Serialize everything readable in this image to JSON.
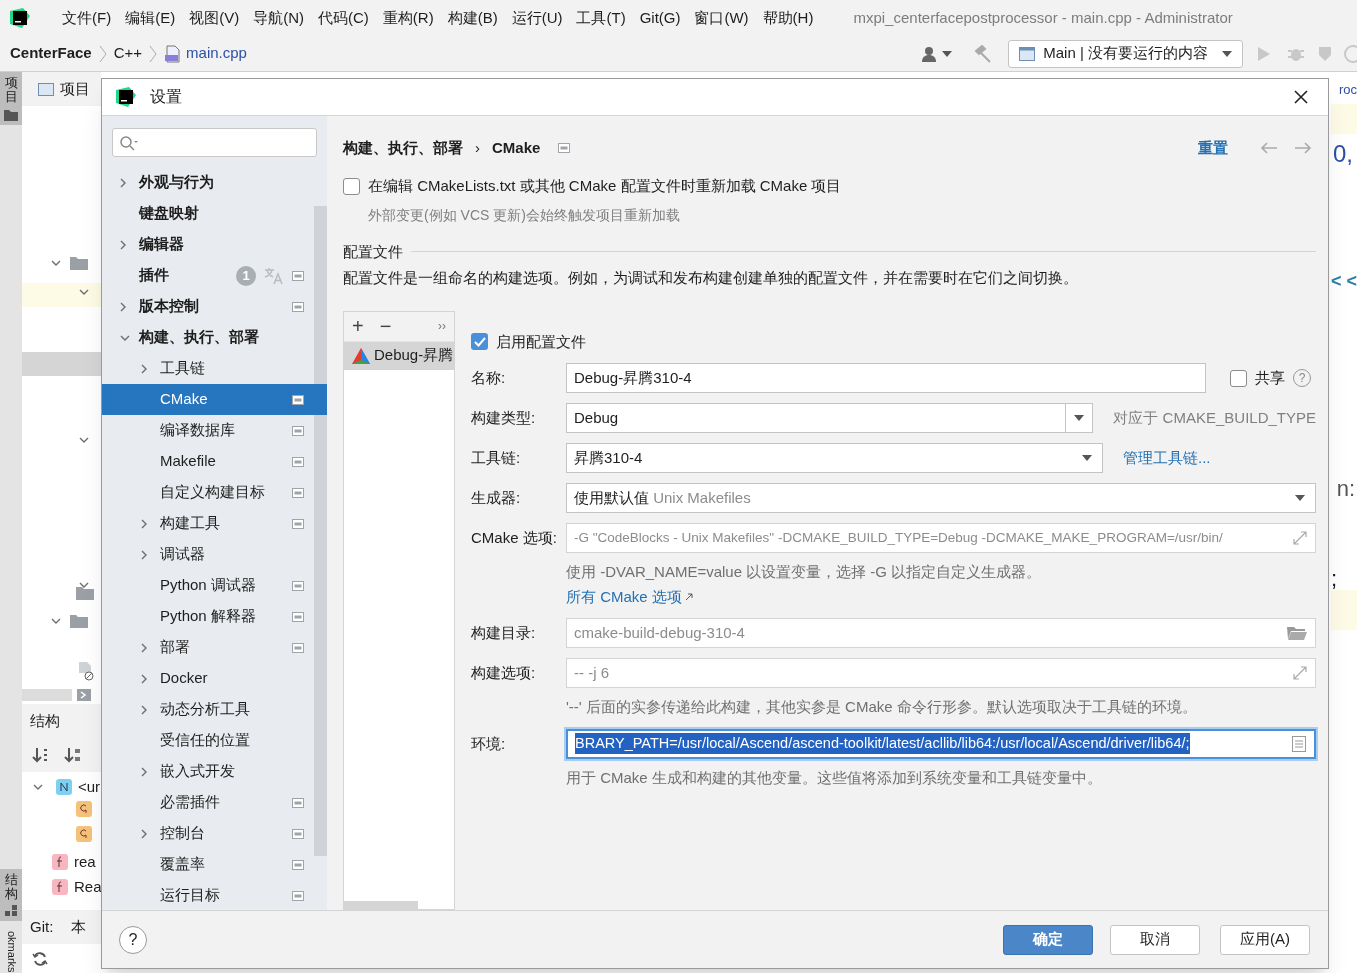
{
  "ide": {
    "menu": [
      "文件(F)",
      "编辑(E)",
      "视图(V)",
      "导航(N)",
      "代码(C)",
      "重构(R)",
      "构建(B)",
      "运行(U)",
      "工具(T)",
      "Git(G)",
      "窗口(W)",
      "帮助(H)"
    ],
    "window_title": "mxpi_centerfacepostprocessor - main.cpp - Administrator",
    "breadcrumb": [
      "CenterFace",
      "C++",
      "main.cpp"
    ],
    "run_config": "Main | 没有要运行的内容",
    "side_tabs": [
      {
        "label": "项目",
        "selected": true
      },
      {
        "label": "结构",
        "selected": true
      },
      {
        "label": "okmarks",
        "selected": false
      }
    ],
    "project_header": "项目",
    "structure_header": "结构",
    "structure_items": [
      {
        "kind": "namespace",
        "label": "<ur"
      },
      {
        "kind": "function",
        "label": "rea"
      },
      {
        "kind": "function",
        "label": "Rea"
      }
    ],
    "git_label": "Git:",
    "git_tab": "本",
    "editor_peek": [
      "roc",
      "0,",
      "< <",
      "n:",
      ";"
    ]
  },
  "dialog": {
    "title": "设置",
    "tree": [
      {
        "label": "外观与行为",
        "expanded": false,
        "selected": false,
        "project_level": false
      },
      {
        "label": "键盘映射",
        "selected": false,
        "project_level": false
      },
      {
        "label": "编辑器",
        "expanded": false,
        "selected": false,
        "project_level": false
      },
      {
        "label": "插件",
        "selected": false,
        "project_level": true,
        "badge": "1",
        "translate": true
      },
      {
        "label": "版本控制",
        "expanded": false,
        "selected": false,
        "project_level": true
      },
      {
        "label": "构建、执行、部署",
        "expanded": true,
        "selected": false,
        "project_level": false,
        "children": [
          {
            "label": "工具链",
            "expanded": false,
            "selected": false,
            "project_level": false
          },
          {
            "label": "CMake",
            "selected": true,
            "project_level": true
          },
          {
            "label": "编译数据库",
            "selected": false,
            "project_level": true
          },
          {
            "label": "Makefile",
            "selected": false,
            "project_level": true
          },
          {
            "label": "自定义构建目标",
            "selected": false,
            "project_level": true
          },
          {
            "label": "构建工具",
            "expanded": false,
            "selected": false,
            "project_level": true
          },
          {
            "label": "调试器",
            "expanded": false,
            "selected": false,
            "project_level": false
          },
          {
            "label": "Python 调试器",
            "selected": false,
            "project_level": true
          },
          {
            "label": "Python 解释器",
            "selected": false,
            "project_level": true
          },
          {
            "label": "部署",
            "expanded": false,
            "selected": false,
            "project_level": true
          },
          {
            "label": "Docker",
            "expanded": false,
            "selected": false,
            "project_level": false
          },
          {
            "label": "动态分析工具",
            "expanded": false,
            "selected": false,
            "project_level": false
          },
          {
            "label": "受信任的位置",
            "selected": false,
            "project_level": false
          },
          {
            "label": "嵌入式开发",
            "expanded": false,
            "selected": false,
            "project_level": false
          },
          {
            "label": "必需插件",
            "selected": false,
            "project_level": true
          },
          {
            "label": "控制台",
            "expanded": false,
            "selected": false,
            "project_level": true
          },
          {
            "label": "覆盖率",
            "selected": false,
            "project_level": true
          },
          {
            "label": "运行目标",
            "selected": false,
            "project_level": true
          }
        ]
      }
    ],
    "breadcrumb": [
      "构建、执行、部署",
      "CMake"
    ],
    "breadcrumb_separator": "›",
    "reset": "重置",
    "reload": {
      "label": "在编辑 CMakeLists.txt 或其他 CMake 配置文件时重新加载 CMake 项目",
      "checked": false,
      "hint": "外部变更(例如 VCS 更新)会始终触发项目重新加载"
    },
    "profiles": {
      "title": "配置文件",
      "description": "配置文件是一组命名的构建选项。例如，为调试和发布构建创建单独的配置文件，并在需要时在它们之间切换。",
      "toolbar": [
        "+",
        "−",
        "››"
      ],
      "items": [
        {
          "label": "Debug-昇腾",
          "selected": true
        }
      ]
    },
    "enable": {
      "label": "启用配置文件",
      "checked": true
    },
    "fields": [
      {
        "kind": "text",
        "label": "名称:",
        "value": "Debug-昇腾310-4",
        "share": {
          "label": "共享",
          "checked": false,
          "help": "?"
        }
      },
      {
        "kind": "editable_combo",
        "label": "构建类型:",
        "value": "Debug",
        "note": "对应于 CMAKE_BUILD_TYPE"
      },
      {
        "kind": "combo",
        "label": "工具链:",
        "value": "昇腾310-4",
        "link": "管理工具链..."
      },
      {
        "kind": "combo_wide",
        "label": "生成器:",
        "value": "使用默认值",
        "value_hint": "Unix Makefiles"
      },
      {
        "kind": "expand",
        "label": "CMake 选项:",
        "placeholder": "-G \"CodeBlocks - Unix Makefiles\" -DCMAKE_BUILD_TYPE=Debug -DCMAKE_MAKE_PROGRAM=/usr/bin/",
        "help": "使用 -DVAR_NAME=value 以设置变量，选择 -G 以指定自定义生成器。",
        "help_link": "所有 CMake 选项"
      },
      {
        "kind": "folder",
        "label": "构建目录:",
        "placeholder": "cmake-build-debug-310-4"
      },
      {
        "kind": "expand",
        "label": "构建选项:",
        "placeholder": "-- -j 6",
        "help": "'--' 后面的实参传递给此构建，其他实参是 CMake 命令行形参。默认选项取决于工具链的环境。"
      },
      {
        "kind": "env",
        "label": "环境:",
        "value": "BRARY_PATH=/usr/local/Ascend/ascend-toolkit/latest/acllib/lib64:/usr/local/Ascend/driver/lib64/;",
        "focused": true,
        "help": "用于 CMake 生成和构建的其他变量。这些值将添加到系统变量和工具链变量中。"
      }
    ],
    "buttons": [
      {
        "label": "确定",
        "primary": true
      },
      {
        "label": "取消",
        "primary": false
      },
      {
        "label": "应用(A)",
        "primary": false
      }
    ],
    "help": "?"
  }
}
